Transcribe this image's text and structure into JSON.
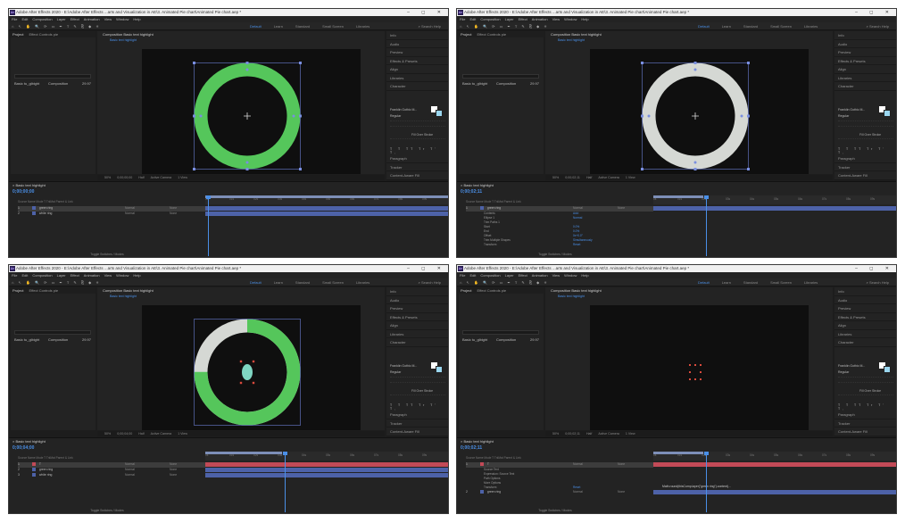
{
  "app": {
    "title": "Adobe After Effects 2020 - E:\\Adobe After Effects ...arts and Visualization in AE\\3. Animated Pie chart\\Animated Pie chart.aep *",
    "icon_label": "Ae",
    "menu": [
      "File",
      "Edit",
      "Composition",
      "Layer",
      "Effect",
      "Animation",
      "View",
      "Window",
      "Help"
    ],
    "workspaces": [
      "Default",
      "Learn",
      "Standard",
      "Small Screen",
      "Libraries"
    ],
    "search_label": "Search Help"
  },
  "panels": {
    "project_tabs": [
      "Project",
      "Effect Controls pie"
    ],
    "project_item": {
      "name": "Basic tu_glbight",
      "type": "Composition",
      "size": "29.97"
    },
    "comp_tab": "Composition Basic text highlight",
    "comp_crumb": "Basic text highlight",
    "right_items": [
      "Info",
      "Audio",
      "Preview",
      "Effects & Presets",
      "Align",
      "Libraries",
      "Character"
    ],
    "right_items_lower": [
      "Paragraph",
      "Tracker",
      "Content-Aware Fill"
    ],
    "character": {
      "font": "Franklin Gothic M...",
      "style": "Regular",
      "fill_over_stroke": "Fill Over Stroke",
      "styles": "T T TT Tr T' T,"
    },
    "view_bar": [
      "50%",
      "0;00;00;00",
      "Half",
      "Active Camera",
      "1 View"
    ],
    "timeline_tab": "Basic text highlight",
    "columns": "Source Name   Mode   T TrkMat   Parent & Link",
    "ruler_ticks": [
      "0s",
      "01s",
      "02s",
      "03s",
      "04s",
      "05s",
      "06s",
      "07s",
      "08s",
      "09s"
    ],
    "toggle_label": "Toggle Switches / Modes"
  },
  "quadrants": [
    {
      "timecode": "0;00;00;00",
      "layers": [
        {
          "num": "1",
          "name": "green ring",
          "mode": "Normal",
          "parent": "None",
          "selected": true
        },
        {
          "num": "2",
          "name": "white ring",
          "mode": "Normal",
          "parent": "None",
          "selected": false
        }
      ],
      "props": []
    },
    {
      "timecode": "0;00;02;11",
      "layers": [
        {
          "num": "1",
          "name": "green ring",
          "mode": "Normal",
          "parent": "None",
          "selected": true
        }
      ],
      "props": [
        {
          "name": "Contents",
          "value": "Add: "
        },
        {
          "name": "Ellipse 1",
          "value": "Normal"
        },
        {
          "name": "Trim Paths 1",
          "value": ""
        },
        {
          "name": "Start",
          "value": "0.0%"
        },
        {
          "name": "End",
          "value": "0.0%"
        },
        {
          "name": "Offset",
          "value": "0x+0.0°"
        },
        {
          "name": "Trim Multiple Shapes",
          "value": "Simultaneously"
        },
        {
          "name": "Transform",
          "value": "Reset"
        }
      ]
    },
    {
      "timecode": "0;00;04;00",
      "layers": [
        {
          "num": "1",
          "name": "T",
          "mode": "Normal",
          "parent": "None",
          "selected": true
        },
        {
          "num": "2",
          "name": "green ring",
          "mode": "Normal",
          "parent": "None",
          "selected": false
        },
        {
          "num": "3",
          "name": "white ring",
          "mode": "Normal",
          "parent": "None",
          "selected": false
        }
      ],
      "props": []
    },
    {
      "timecode": "0;00;02;11",
      "layers": [
        {
          "num": "1",
          "name": "T",
          "mode": "Normal",
          "parent": "None",
          "selected": true
        },
        {
          "num": "2",
          "name": "green ring",
          "mode": "Normal",
          "parent": "None",
          "selected": false
        }
      ],
      "props": [
        {
          "name": "Source Text",
          "value": ""
        },
        {
          "name": "Expression: Source Text",
          "value": ""
        },
        {
          "name": "Path Options",
          "value": ""
        },
        {
          "name": "More Options",
          "value": ""
        },
        {
          "name": "Transform",
          "value": "Reset"
        }
      ],
      "expression": "Math.round(thisComp.layer(\"green ring\").content(..."
    }
  ],
  "colors": {
    "green": "#55c65b",
    "white_ring": "#d5d8d4",
    "accent_blue": "#4a8fe7",
    "layer_red": "#c24a57",
    "layer_blue": "#4d62a8"
  }
}
